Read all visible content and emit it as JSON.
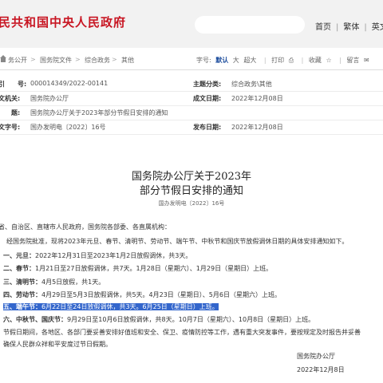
{
  "header": {
    "site_name": "民共和国中央人民政府",
    "nav": [
      "首页",
      "繁体",
      "英文"
    ],
    "separator": "|"
  },
  "breadcrumb": {
    "items": [
      "务公开",
      "国务院文件",
      "综合政务",
      "其他"
    ],
    "font_label": "字号:",
    "font_default": "默认",
    "font_large": "大",
    "font_xlarge": "超大",
    "print": "打印",
    "favorite": "收藏",
    "message": "留言"
  },
  "meta": {
    "index_label": "引　　号:",
    "index_value": "000014349/2022-00141",
    "topic_label": "主题分类:",
    "topic_value": "综合政务\\其他",
    "issuer_label": "文机关:",
    "issuer_value": "国务院办公厅",
    "written_label": "成文日期:",
    "written_value": "2022年12月08日",
    "title_label": "　　题:",
    "title_value": "国务院办公厅关于2023年部分节假日安排的通知",
    "docno_label": "文字号:",
    "docno_value": "国办发明电〔2022〕16号",
    "publish_label": "发布日期:",
    "publish_value": "2022年12月08日"
  },
  "document": {
    "title_line1": "国务院办公厅关于2023年",
    "title_line2": "部分节假日安排的通知",
    "doc_number": "国办发明电〔2022〕16号",
    "recipients": "省、自治区、直辖市人民政府，国务院各部委、各直属机构：",
    "intro": "　经国务院批准，现将2023年元旦、春节、清明节、劳动节、端午节、中秋节和国庆节放假调休日期的具体安排通知如下。",
    "items": [
      {
        "label": "一、元旦：",
        "text": "2022年12月31日至2023年1月2日放假调休，共3天。"
      },
      {
        "label": "二、春节：",
        "text": "1月21日至27日放假调休，共7天。1月28日（星期六）、1月29日（星期日）上班。"
      },
      {
        "label": "三、清明节：",
        "text": "4月5日放假，共1天。"
      },
      {
        "label": "四、劳动节：",
        "text": "4月29日至5月3日放假调休，共5天。4月23日（星期日）、5月6日（星期六）上班。"
      },
      {
        "label": "五、端午节：",
        "text": "6月22日至24日放假调休，共3天。6月25日（星期日）上班。"
      },
      {
        "label": "六、中秋节、国庆节：",
        "text": "9月29日至10月6日放假调休，共8天。10月7日（星期六）、10月8日（星期日）上班。"
      }
    ],
    "closing_line1": "节假日期间，各地区、各部门要妥善安排好值班和安全、保卫、疫情防控等工作，遇有重大突发事件，要按规定及时报告并妥善",
    "closing_line2": "确保人民群众祥和平安度过节日假期。",
    "signature": "国务院办公厅",
    "date": "2022年12月8日"
  }
}
